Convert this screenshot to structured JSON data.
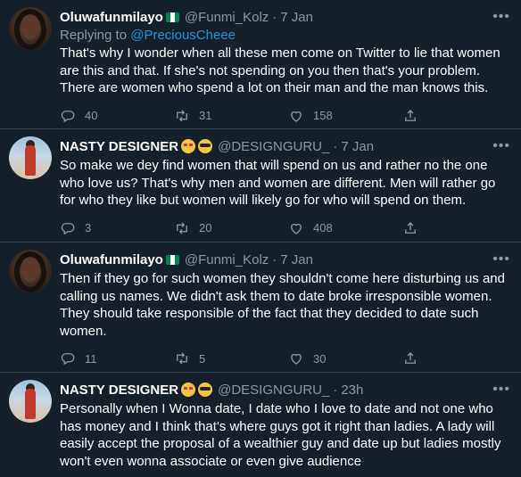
{
  "tweets": [
    {
      "name": "Oluwafunmilayo",
      "handle": "@Funmi_Kolz",
      "separator": "·",
      "time": "7 Jan",
      "reply_prefix": "Replying to",
      "reply_to": "@PreciousCheee",
      "text": "That's why I wonder when all these men come on Twitter to lie that women are this and that. If she's not spending on you then that's your problem. There are women who spend a lot on their man and the man knows this.",
      "replies": "40",
      "retweets": "31",
      "likes": "158"
    },
    {
      "name": "NASTY DESIGNER",
      "handle": "@DESIGNGURU_",
      "separator": "·",
      "time": "7 Jan",
      "text": "So make we dey find women that will spend on us and rather no the one who love us? That's why men and women are different. Men will rather go for who they like but women will likely go for who will spend on them.",
      "replies": "3",
      "retweets": "20",
      "likes": "408"
    },
    {
      "name": "Oluwafunmilayo",
      "handle": "@Funmi_Kolz",
      "separator": "·",
      "time": "7 Jan",
      "text": "Then if they go for such women they shouldn't come here disturbing us and calling us names. We didn't ask them to date broke irresponsible women. They should take responsible of the fact that they decided to date such women.",
      "replies": "11",
      "retweets": "5",
      "likes": "30"
    },
    {
      "name": "NASTY DESIGNER",
      "handle": "@DESIGNGURU_",
      "separator": "·",
      "time": "23h",
      "text": "Personally when I Wonna date, I date who I love to date and not one who has money and I think that's where guys got it right than ladies. A lady will easily accept the proposal of a wealthier guy and date up but ladies mostly won't even wonna associate or even give audience"
    }
  ],
  "icons": {
    "verified_flag": "nigeria-flag-icon",
    "emoji_1": "heart-eyes-emoji-icon",
    "emoji_2": "sunglasses-emoji-icon",
    "reply": "reply-icon",
    "retweet": "retweet-icon",
    "like": "heart-icon",
    "share": "share-icon",
    "more": "more-icon"
  },
  "colors": {
    "background": "#15202b",
    "secondary_text": "#8899a6",
    "link": "#1b95e0",
    "divider": "#38444d"
  }
}
